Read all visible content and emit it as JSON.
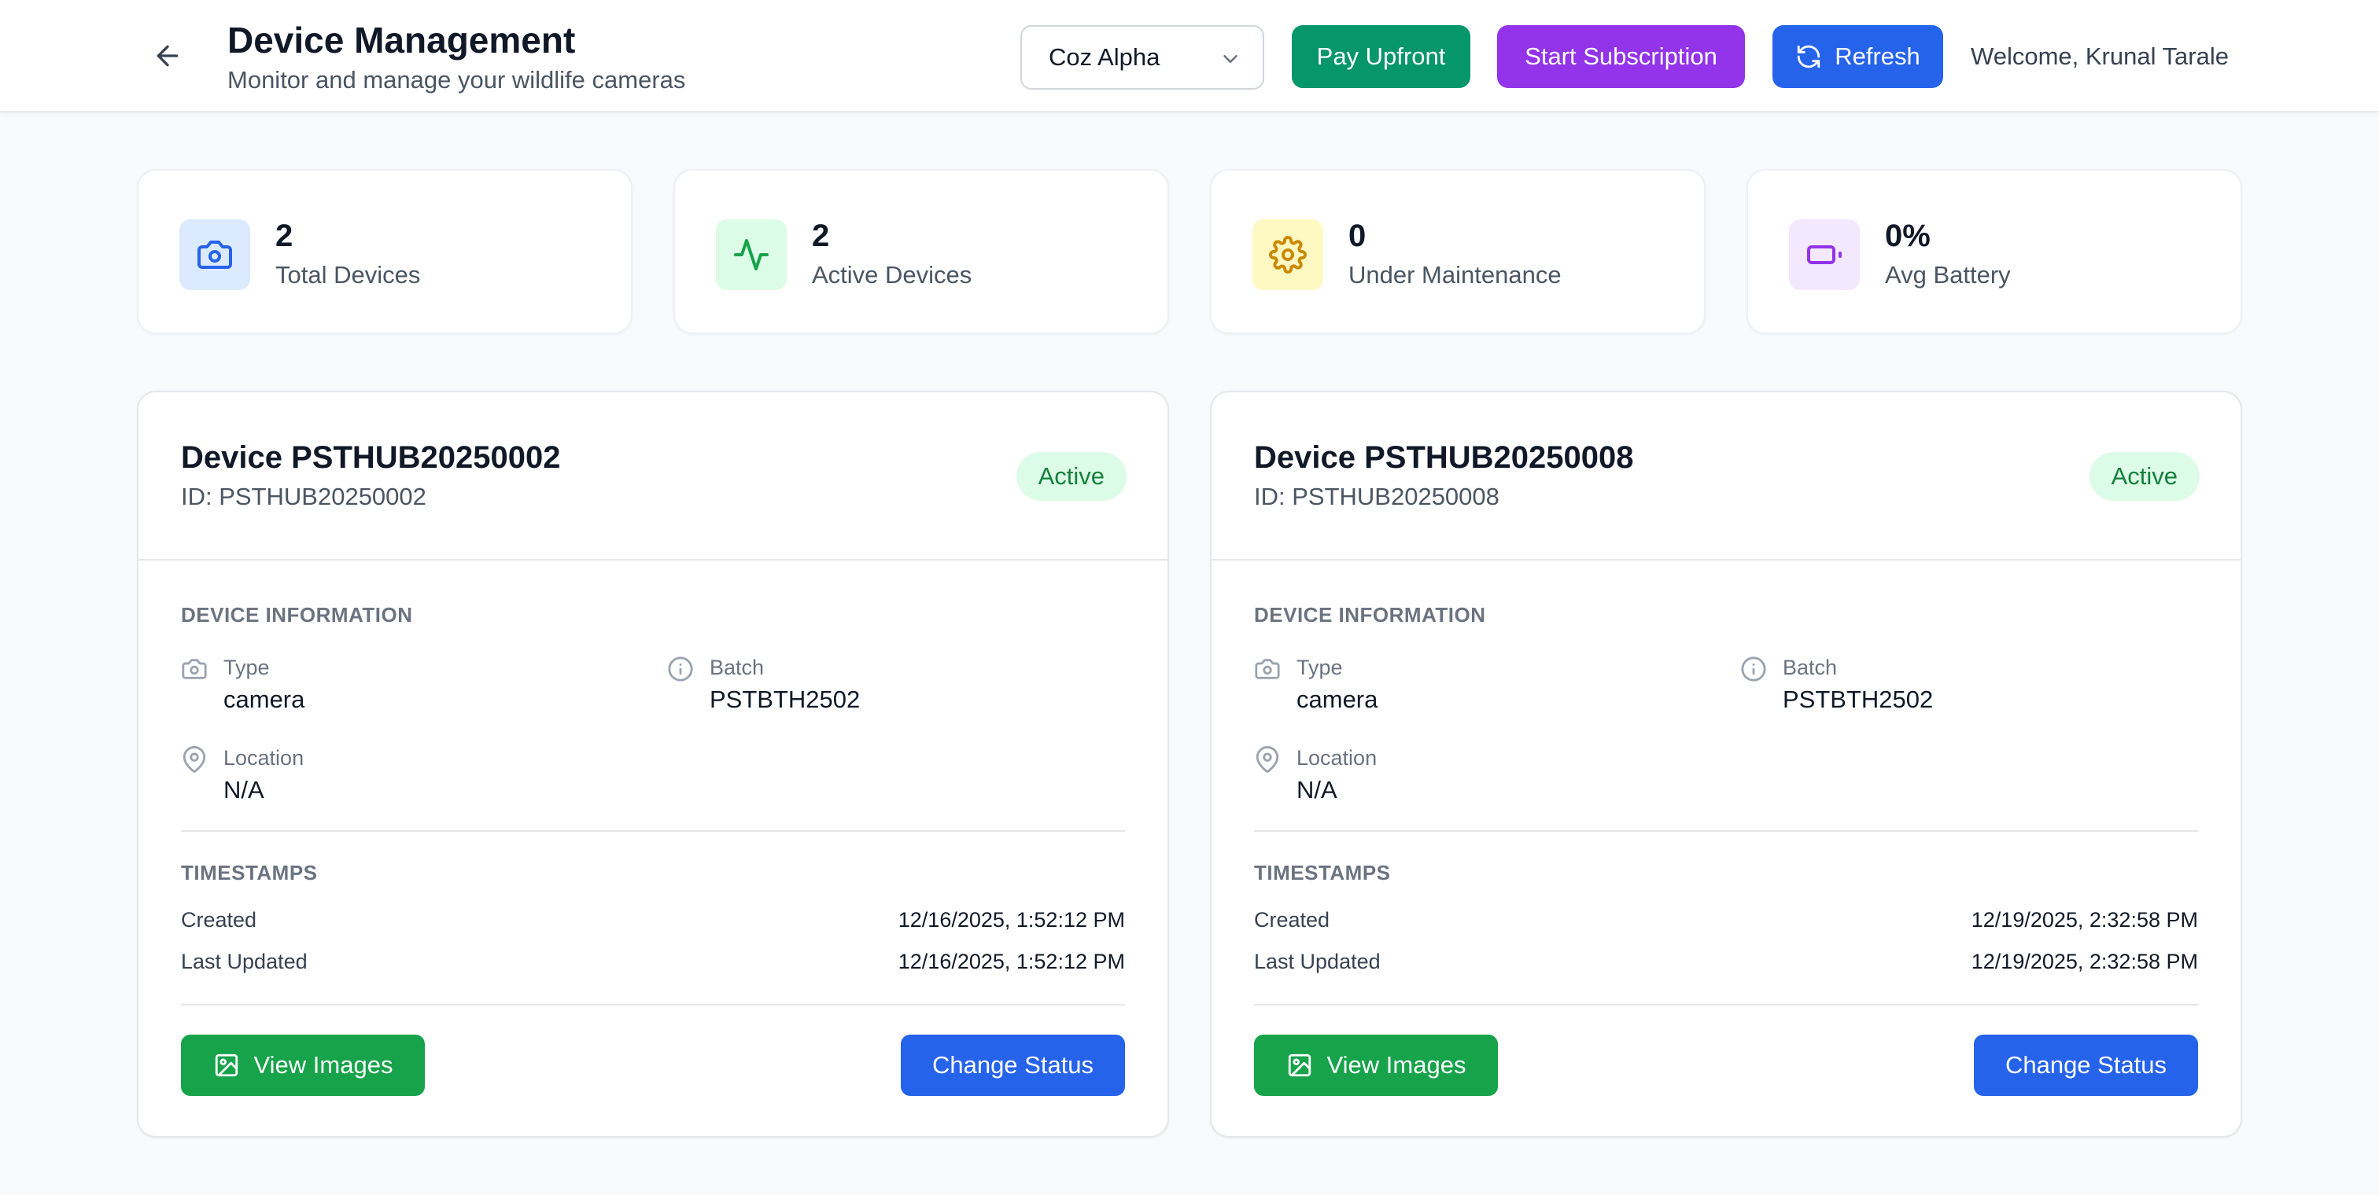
{
  "header": {
    "title": "Device Management",
    "subtitle": "Monitor and manage your wildlife cameras",
    "org_select": {
      "value": "Coz Alpha"
    },
    "pay_upfront_label": "Pay Upfront",
    "start_subscription_label": "Start Subscription",
    "refresh_label": "Refresh",
    "welcome_text": "Welcome, Krunal Tarale"
  },
  "stats": [
    {
      "value": "2",
      "label": "Total Devices",
      "icon": "camera-icon",
      "color": "#2563eb",
      "bg": "#dbeafe"
    },
    {
      "value": "2",
      "label": "Active Devices",
      "icon": "activity-icon",
      "color": "#16a34a",
      "bg": "#dcfce7"
    },
    {
      "value": "0",
      "label": "Under Maintenance",
      "icon": "gear-icon",
      "color": "#ca8a04",
      "bg": "#fef9c3"
    },
    {
      "value": "0%",
      "label": "Avg Battery",
      "icon": "battery-icon",
      "color": "#9333ea",
      "bg": "#f3e8ff"
    }
  ],
  "devices": [
    {
      "title": "Device PSTHUB20250002",
      "id_text": "ID: PSTHUB20250002",
      "status": "Active",
      "info_heading": "DEVICE INFORMATION",
      "type_label": "Type",
      "type_value": "camera",
      "batch_label": "Batch",
      "batch_value": "PSTBTH2502",
      "location_label": "Location",
      "location_value": "N/A",
      "timestamps_heading": "TIMESTAMPS",
      "created_label": "Created",
      "created_value": "12/16/2025, 1:52:12 PM",
      "updated_label": "Last Updated",
      "updated_value": "12/16/2025, 1:52:12 PM",
      "view_images_label": "View Images",
      "change_status_label": "Change Status"
    },
    {
      "title": "Device PSTHUB20250008",
      "id_text": "ID: PSTHUB20250008",
      "status": "Active",
      "info_heading": "DEVICE INFORMATION",
      "type_label": "Type",
      "type_value": "camera",
      "batch_label": "Batch",
      "batch_value": "PSTBTH2502",
      "location_label": "Location",
      "location_value": "N/A",
      "timestamps_heading": "TIMESTAMPS",
      "created_label": "Created",
      "created_value": "12/19/2025, 2:32:58 PM",
      "updated_label": "Last Updated",
      "updated_value": "12/19/2025, 2:32:58 PM",
      "view_images_label": "View Images",
      "change_status_label": "Change Status"
    }
  ]
}
